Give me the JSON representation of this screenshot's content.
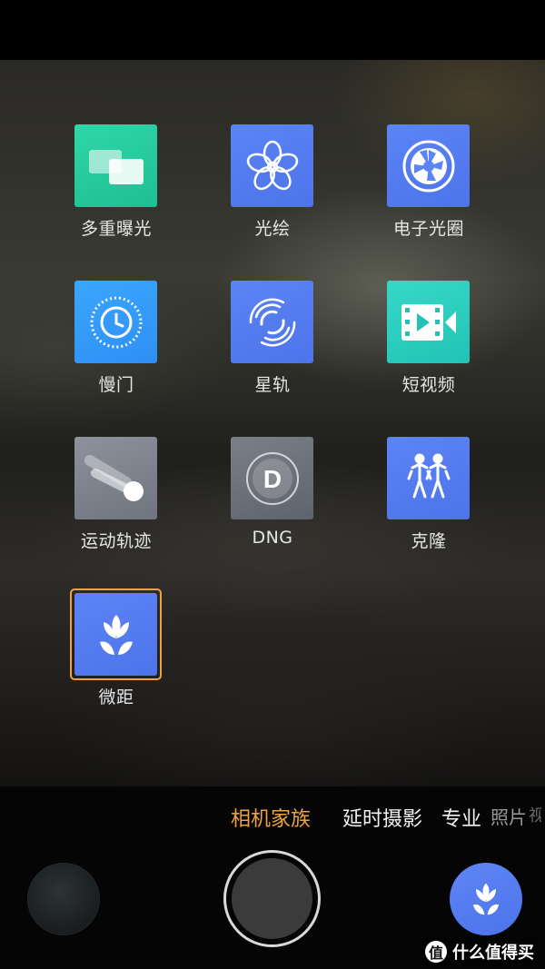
{
  "modes": [
    {
      "label": "多重曝光",
      "icon": "multiple-exposure-icon"
    },
    {
      "label": "光绘",
      "icon": "light-painting-icon"
    },
    {
      "label": "电子光圈",
      "icon": "aperture-icon"
    },
    {
      "label": "慢门",
      "icon": "slow-shutter-icon"
    },
    {
      "label": "星轨",
      "icon": "star-trail-icon"
    },
    {
      "label": "短视频",
      "icon": "short-video-icon"
    },
    {
      "label": "运动轨迹",
      "icon": "motion-trail-icon"
    },
    {
      "label": "DNG",
      "icon": "dng-icon"
    },
    {
      "label": "克隆",
      "icon": "clone-icon"
    },
    {
      "label": "微距",
      "icon": "macro-icon",
      "selected": true
    }
  ],
  "mode_tabs": [
    {
      "label": "相机家族",
      "active": true
    },
    {
      "label": "延时摄影"
    },
    {
      "label": "专业"
    },
    {
      "label": "照片"
    },
    {
      "label": "视频"
    }
  ],
  "watermark": {
    "badge": "值",
    "text": "什么值得买"
  },
  "colors": {
    "accent": "#f0a33c",
    "tile_blue": "#5b84f5",
    "tile_teal": "#2fd6a8"
  }
}
